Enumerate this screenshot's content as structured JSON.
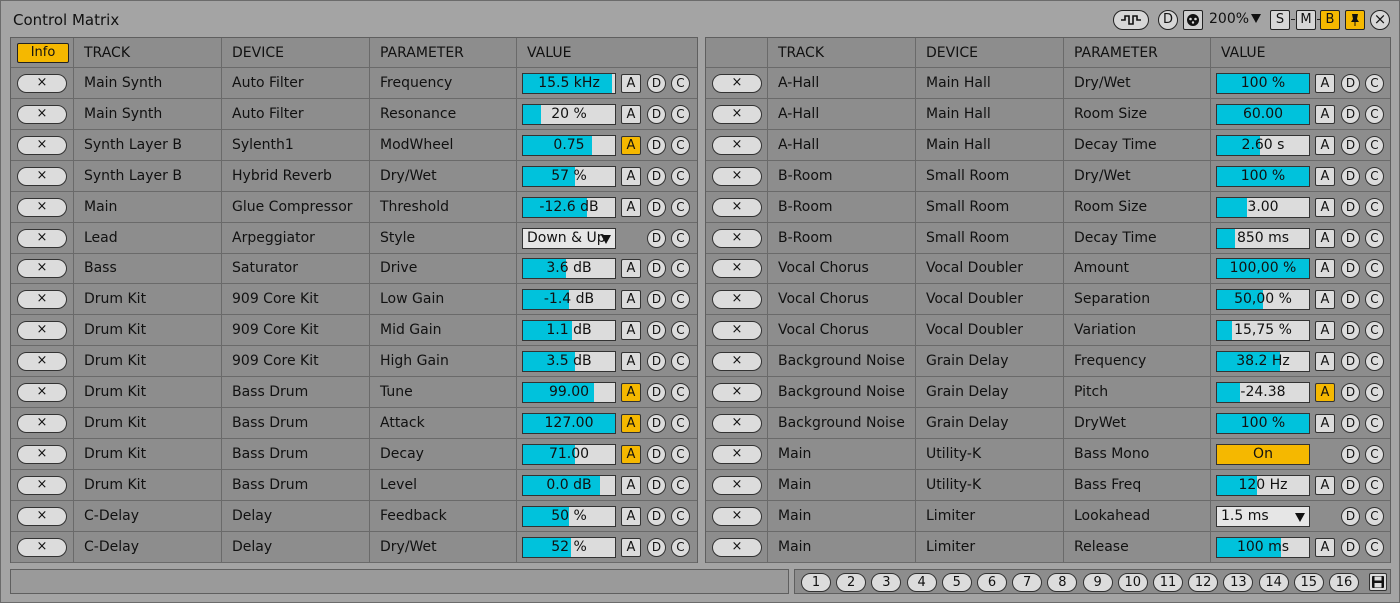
{
  "window": {
    "title": "Control Matrix",
    "zoom": "200%",
    "controls": {
      "d_label": "D",
      "s_label": "S",
      "m_label": "M",
      "b_label": "B",
      "close_label": "×"
    }
  },
  "colors": {
    "accent": "#f5b800",
    "fill": "#00c2dc",
    "panel": "#8d8d8d",
    "background": "#a4a4a4"
  },
  "left": {
    "info_label": "Info",
    "headers": [
      "TRACK",
      "DEVICE",
      "PARAMETER",
      "VALUE"
    ],
    "rows": [
      {
        "track": "Main Synth",
        "device": "Auto Filter",
        "param": "Frequency",
        "kind": "bar",
        "value": "15.5 kHz",
        "fill": 0.97,
        "auto": "A",
        "auto_on": false
      },
      {
        "track": "Main Synth",
        "device": "Auto Filter",
        "param": "Resonance",
        "kind": "bar",
        "value": "20 %",
        "fill": 0.2,
        "auto": "A",
        "auto_on": false
      },
      {
        "track": "Synth Layer B",
        "device": "Sylenth1",
        "param": "ModWheel",
        "kind": "bar",
        "value": "0.75",
        "fill": 0.75,
        "auto": "A",
        "auto_on": true
      },
      {
        "track": "Synth Layer B",
        "device": "Hybrid Reverb",
        "param": "Dry/Wet",
        "kind": "bar",
        "value": "57 %",
        "fill": 0.57,
        "auto": "A",
        "auto_on": false
      },
      {
        "track": "Main",
        "device": "Glue Compressor",
        "param": "Threshold",
        "kind": "bar",
        "value": "-12.6 dB",
        "fill": 0.7,
        "auto": "A",
        "auto_on": false
      },
      {
        "track": "Lead",
        "device": "Arpeggiator",
        "param": "Style",
        "kind": "dropdown",
        "value": "Down & Up"
      },
      {
        "track": "Bass",
        "device": "Saturator",
        "param": "Drive",
        "kind": "bar",
        "value": "3.6 dB",
        "fill": 0.47,
        "auto": "A",
        "auto_on": false
      },
      {
        "track": "Drum Kit",
        "device": "909 Core Kit",
        "param": "Low Gain",
        "kind": "bar",
        "value": "-1.4 dB",
        "fill": 0.5,
        "auto": "A",
        "auto_on": false
      },
      {
        "track": "Drum Kit",
        "device": "909 Core Kit",
        "param": "Mid Gain",
        "kind": "bar",
        "value": "1.1 dB",
        "fill": 0.53,
        "auto": "A",
        "auto_on": false
      },
      {
        "track": "Drum Kit",
        "device": "909 Core Kit",
        "param": "High Gain",
        "kind": "bar",
        "value": "3.5 dB",
        "fill": 0.56,
        "auto": "A",
        "auto_on": false
      },
      {
        "track": "Drum Kit",
        "device": "Bass Drum",
        "param": "Tune",
        "kind": "bar",
        "value": "99.00",
        "fill": 0.77,
        "auto": "A",
        "auto_on": true
      },
      {
        "track": "Drum Kit",
        "device": "Bass Drum",
        "param": "Attack",
        "kind": "bar",
        "value": "127.00",
        "fill": 1.0,
        "auto": "A",
        "auto_on": true
      },
      {
        "track": "Drum Kit",
        "device": "Bass Drum",
        "param": "Decay",
        "kind": "bar",
        "value": "71.00",
        "fill": 0.57,
        "auto": "A",
        "auto_on": true
      },
      {
        "track": "Drum Kit",
        "device": "Bass Drum",
        "param": "Level",
        "kind": "bar",
        "value": "0.0 dB",
        "fill": 0.84,
        "auto": "A",
        "auto_on": false
      },
      {
        "track": "C-Delay",
        "device": "Delay",
        "param": "Feedback",
        "kind": "bar",
        "value": "50 %",
        "fill": 0.5,
        "auto": "A",
        "auto_on": false
      },
      {
        "track": "C-Delay",
        "device": "Delay",
        "param": "Dry/Wet",
        "kind": "bar",
        "value": "52 %",
        "fill": 0.52,
        "auto": "A",
        "auto_on": false
      }
    ]
  },
  "right": {
    "headers": [
      "TRACK",
      "DEVICE",
      "PARAMETER",
      "VALUE"
    ],
    "rows": [
      {
        "track": "A-Hall",
        "device": "Main Hall",
        "param": "Dry/Wet",
        "kind": "bar",
        "value": "100 %",
        "fill": 1.0,
        "auto": "A",
        "auto_on": false
      },
      {
        "track": "A-Hall",
        "device": "Main Hall",
        "param": "Room Size",
        "kind": "bar",
        "value": "60.00",
        "fill": 1.0,
        "auto": "A",
        "auto_on": false
      },
      {
        "track": "A-Hall",
        "device": "Main Hall",
        "param": "Decay Time",
        "kind": "bar",
        "value": "2.60 s",
        "fill": 0.47,
        "auto": "A",
        "auto_on": false
      },
      {
        "track": "B-Room",
        "device": "Small Room",
        "param": "Dry/Wet",
        "kind": "bar",
        "value": "100 %",
        "fill": 1.0,
        "auto": "A",
        "auto_on": false
      },
      {
        "track": "B-Room",
        "device": "Small Room",
        "param": "Room Size",
        "kind": "bar",
        "value": "3.00",
        "fill": 0.33,
        "auto": "A",
        "auto_on": false
      },
      {
        "track": "B-Room",
        "device": "Small Room",
        "param": "Decay Time",
        "kind": "bar",
        "value": "850 ms",
        "fill": 0.2,
        "auto": "A",
        "auto_on": false
      },
      {
        "track": "Vocal Chorus",
        "device": "Vocal Doubler",
        "param": "Amount",
        "kind": "bar",
        "value": "100,00 %",
        "fill": 1.0,
        "auto": "A",
        "auto_on": false
      },
      {
        "track": "Vocal Chorus",
        "device": "Vocal Doubler",
        "param": "Separation",
        "kind": "bar",
        "value": "50,00 %",
        "fill": 0.5,
        "auto": "A",
        "auto_on": false
      },
      {
        "track": "Vocal Chorus",
        "device": "Vocal Doubler",
        "param": "Variation",
        "kind": "bar",
        "value": "15,75 %",
        "fill": 0.16,
        "auto": "A",
        "auto_on": false
      },
      {
        "track": "Background Noise",
        "device": "Grain Delay",
        "param": "Frequency",
        "kind": "bar",
        "value": "38.2 Hz",
        "fill": 0.68,
        "auto": "A",
        "auto_on": false
      },
      {
        "track": "Background Noise",
        "device": "Grain Delay",
        "param": "Pitch",
        "kind": "bar",
        "value": "-24.38",
        "fill": 0.25,
        "auto": "A",
        "auto_on": true
      },
      {
        "track": "Background Noise",
        "device": "Grain Delay",
        "param": "DryWet",
        "kind": "bar",
        "value": "100 %",
        "fill": 1.0,
        "auto": "A",
        "auto_on": false
      },
      {
        "track": "Main",
        "device": "Utility-K",
        "param": "Bass Mono",
        "kind": "toggle",
        "value": "On"
      },
      {
        "track": "Main",
        "device": "Utility-K",
        "param": "Bass Freq",
        "kind": "bar",
        "value": "120 Hz",
        "fill": 0.43,
        "auto": "A",
        "auto_on": false
      },
      {
        "track": "Main",
        "device": "Limiter",
        "param": "Lookahead",
        "kind": "dropdown",
        "value": "1.5 ms"
      },
      {
        "track": "Main",
        "device": "Limiter",
        "param": "Release",
        "kind": "bar",
        "value": "100 ms",
        "fill": 0.7,
        "auto": "A",
        "auto_on": false
      }
    ]
  },
  "row_buttons": {
    "remove": "×",
    "d": "D",
    "c": "C"
  },
  "pages": [
    "1",
    "2",
    "3",
    "4",
    "5",
    "6",
    "7",
    "8",
    "9",
    "10",
    "11",
    "12",
    "13",
    "14",
    "15",
    "16"
  ]
}
